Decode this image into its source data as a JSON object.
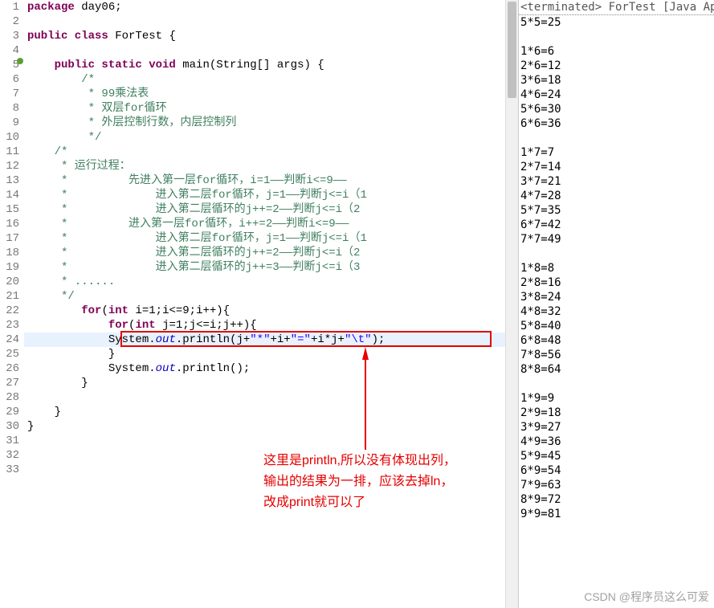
{
  "editor": {
    "line_numbers": [
      "1",
      "2",
      "3",
      "4",
      "5",
      "6",
      "7",
      "8",
      "9",
      "10",
      "11",
      "12",
      "13",
      "14",
      "15",
      "16",
      "17",
      "18",
      "19",
      "20",
      "21",
      "22",
      "23",
      "24",
      "25",
      "26",
      "27",
      "28",
      "29",
      "30",
      "31",
      "32",
      "33"
    ],
    "lines": {
      "pkg_kw": "package",
      "pkg_nm": " day06;",
      "cls_kw": "public class",
      "cls_nm": " ForTest {",
      "main_kw1": "public static void",
      "main_nm": " main(String[] args) {",
      "c1": "        /*",
      "c2": "         * 99乘法表",
      "c3": "         * 双层for循环",
      "c4": "         * 外层控制行数，内层控制列",
      "c5": "         */",
      "c6": "    /*",
      "c7": "     * 运行过程：",
      "c8": "     *         先进入第一层for循环，i=1——判断i<=9——",
      "c9": "     *             进入第二层for循环，j=1——判断j<=i（1",
      "c10": "     *             进入第二层循环的j++=2——判断j<=i（2",
      "c11": "     *         进入第一层for循环，i++=2——判断i<=9——",
      "c12": "     *             进入第二层for循环，j=1——判断j<=i（1",
      "c13": "     *             进入第二层循环的j++=2——判断j<=i（2",
      "c14": "     *             进入第二层循环的j++=3——判断j<=i（3",
      "c15": "     * ......",
      "c16": "     */",
      "for1_kw": "for",
      "for1_body": "(",
      "for1_int": "int",
      "for1_rest": " i=1;i<=9;i++){",
      "for2_kw": "for",
      "for2_body": "(",
      "for2_int": "int",
      "for2_rest": " j=1;j<=i;j++){",
      "sys1_a": "System.",
      "sys1_out": "out",
      "sys1_b": ".println(j+",
      "sys1_s1": "\"*\"",
      "sys1_c": "+i+",
      "sys1_s2": "\"=\"",
      "sys1_d": "+i*j+",
      "sys1_s3": "\"\\t\"",
      "sys1_e": ");",
      "close_inner": "            }",
      "sys2_a": "System.",
      "sys2_out": "out",
      "sys2_b": ".println();",
      "close1": "        }",
      "blank": "",
      "close2": "    }",
      "close3": "}"
    }
  },
  "annotation": {
    "line1": "这里是println,所以没有体现出列，",
    "line2": "输出的结果为一排，应该去掉ln，",
    "line3": "改成print就可以了"
  },
  "output": {
    "header": "<terminated> ForTest [Java App",
    "rows": [
      "5*5=25",
      "",
      "1*6=6",
      "2*6=12",
      "3*6=18",
      "4*6=24",
      "5*6=30",
      "6*6=36",
      "",
      "1*7=7",
      "2*7=14",
      "3*7=21",
      "4*7=28",
      "5*7=35",
      "6*7=42",
      "7*7=49",
      "",
      "1*8=8",
      "2*8=16",
      "3*8=24",
      "4*8=32",
      "5*8=40",
      "6*8=48",
      "7*8=56",
      "8*8=64",
      "",
      "1*9=9",
      "2*9=18",
      "3*9=27",
      "4*9=36",
      "5*9=45",
      "6*9=54",
      "7*9=63",
      "8*9=72",
      "9*9=81"
    ]
  },
  "watermark": "CSDN @程序员这么可爱"
}
